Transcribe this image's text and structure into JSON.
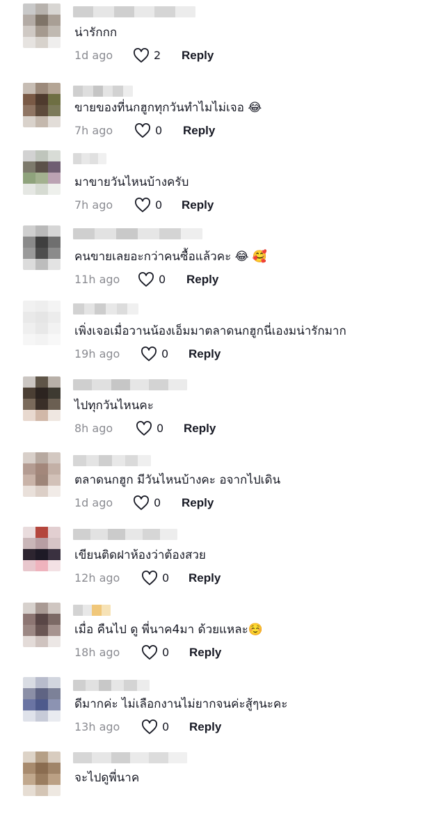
{
  "comments": [
    {
      "text": "น่ารักกก",
      "time": "1d ago",
      "likes": "2",
      "reply": "Reply",
      "avatar": [
        "#c9c9c9",
        "#b7b2ad",
        "#d8d6d3",
        "#b3aba5",
        "#7f7468",
        "#a99f95",
        "#cfc9c4",
        "#a59a8f",
        "#c0b9b1",
        "#e6e3e0",
        "#d7d2cc",
        "#efeeed"
      ],
      "name_blur": [
        "#d0d0d0",
        "#e6e6e6",
        "#cfcfcf",
        "#e9e9e9",
        "#d5d5d5",
        "#ececec"
      ]
    },
    {
      "text": "ขายของที่นกฮูกทุกวันทำไมไม่เจอ 😂",
      "time": "7h ago",
      "likes": "0",
      "reply": "Reply",
      "avatar": [
        "#c7bdb4",
        "#9c8a7b",
        "#b4a595",
        "#7a5a46",
        "#4f3b2e",
        "#6e6f43",
        "#8f7563",
        "#5d4a3b",
        "#7c7a5a",
        "#d9d2cb",
        "#c4b8ad",
        "#e2ddd8"
      ],
      "name_blur": [
        "#cfcfcf",
        "#dedede",
        "#c5c5c5",
        "#e4e4e4",
        "#d2d2d2",
        "#ededed"
      ]
    },
    {
      "text": "มาขายวันไหนบ้างครับ",
      "time": "7h ago",
      "likes": "0",
      "reply": "Reply",
      "avatar": [
        "#d2d2d2",
        "#bfc5bc",
        "#d8dcd6",
        "#7d7a6c",
        "#5b5149",
        "#6f5e72",
        "#8fa37c",
        "#a3b18f",
        "#bba3b3",
        "#e5e7e3",
        "#d6dbd2",
        "#eef0ec"
      ],
      "name_blur": [
        "#dadada",
        "#e8e8e8",
        "#e0e0e0",
        "#f0f0f0"
      ]
    },
    {
      "text": "คนขายเลยอะกว่าคนซื้อแล้วคะ 😂 🥰",
      "time": "11h ago",
      "likes": "0",
      "reply": "Reply",
      "avatar": [
        "#cfcfcf",
        "#b9b9b9",
        "#d6d6d6",
        "#8a8a8a",
        "#3f3f3f",
        "#6f6f6f",
        "#9a9a9a",
        "#4e4e4e",
        "#8b8b8b",
        "#dcdcdc",
        "#bdbdbd",
        "#e3e3e3"
      ],
      "name_blur": [
        "#cfcfcf",
        "#e2e2e2",
        "#c9c9c9",
        "#e6e6e6",
        "#d4d4d4",
        "#eeeeee"
      ]
    },
    {
      "text": "เพิ่งเจอเมื่อวานน้องเอ็มมาตลาดนกฮูกนี่เองมน่ารักมาก",
      "time": "19h ago",
      "likes": "0",
      "reply": "Reply",
      "avatar": [
        "#f1f1f1",
        "#eeeeee",
        "#f4f4f4",
        "#e9e9e9",
        "#e5e5e5",
        "#ececec",
        "#efefef",
        "#e8e8e8",
        "#f2f2f2",
        "#f6f6f6",
        "#f3f3f3",
        "#f8f8f8"
      ],
      "name_blur": [
        "#d2d2d2",
        "#e4e4e4",
        "#cdcdcd",
        "#e8e8e8",
        "#dcdcdc",
        "#f0f0f0"
      ]
    },
    {
      "text": "ไปทุกวันไหนคะ",
      "time": "8h ago",
      "likes": "0",
      "reply": "Reply",
      "avatar": [
        "#cbc6c2",
        "#5f5548",
        "#b8b0a8",
        "#4b3f34",
        "#2c2420",
        "#3e3a31",
        "#7a6a5b",
        "#3a2f28",
        "#6b5f52",
        "#e8d9cf",
        "#d1b8a8",
        "#efe7e1"
      ],
      "name_blur": [
        "#cfcfcf",
        "#e0e0e0",
        "#c6c6c6",
        "#e6e6e6",
        "#d3d3d3",
        "#ebebeb"
      ]
    },
    {
      "text": "ตลาดนกฮูก มีวันไหนบ้างคะ อจากไปเดิน",
      "time": "1d ago",
      "likes": "0",
      "reply": "Reply",
      "avatar": [
        "#d8cfc9",
        "#b7a9a0",
        "#d3c8c1",
        "#b49c92",
        "#a3877b",
        "#c3b0a6",
        "#c9b3a8",
        "#9e8579",
        "#d2c1b8",
        "#e9e0da",
        "#dccfc7",
        "#f1ebe7"
      ],
      "name_blur": [
        "#d6d6d6",
        "#e4e4e4",
        "#cfcfcf",
        "#e8e8e8",
        "#dadada",
        "#efefef"
      ]
    },
    {
      "text": "เขียนติดฝาห้องว่าต้องสวย",
      "time": "12h ago",
      "likes": "0",
      "reply": "Reply",
      "avatar": [
        "#e9dcdd",
        "#b4463d",
        "#e2cfd1",
        "#c9b6b8",
        "#b79ea3",
        "#d6c4c6",
        "#2d2530",
        "#1e1a26",
        "#3a3140",
        "#e8c7cd",
        "#efb3bd",
        "#f3e1e4"
      ],
      "name_blur": [
        "#d0d0d0",
        "#e2e2e2",
        "#cbcbcb",
        "#e7e7e7",
        "#d6d6d6",
        "#ededed"
      ]
    },
    {
      "text": "เมื่อ คืนไป ดู พี่นาค4มา ด้วยแหละ☺️",
      "time": "18h ago",
      "likes": "0",
      "reply": "Reply",
      "avatar": [
        "#d7d1cd",
        "#a99a94",
        "#cfc6c1",
        "#8d7673",
        "#594646",
        "#7c6965",
        "#9c8884",
        "#6a5654",
        "#a6938f",
        "#e3dbd8",
        "#cfc3bf",
        "#ece7e5"
      ],
      "name_blur": [
        "#d3d3d3",
        "#e8e8e8",
        "#f0c77a",
        "#f6e2b6"
      ]
    },
    {
      "text": "ดีมากค่ะ ไม่เลือกงานไม่ยากจนค่ะสู้ๆนะคะ",
      "time": "13h ago",
      "likes": "0",
      "reply": "Reply",
      "avatar": [
        "#d9dce3",
        "#b8bccc",
        "#d2d6df",
        "#8b8fa6",
        "#5f6483",
        "#7c8198",
        "#6a74a3",
        "#4e5a8c",
        "#8c93b2",
        "#dfe2ea",
        "#c7cbd8",
        "#e9ebf0"
      ],
      "name_blur": [
        "#cfcfcf",
        "#e1e1e1",
        "#c8c8c8",
        "#e6e6e6",
        "#d4d4d4",
        "#ececec"
      ]
    },
    {
      "text": "จะไปดูพี่นาค",
      "time": "",
      "likes": "",
      "reply": "",
      "avatar": [
        "#ddd3c7",
        "#b59f86",
        "#d8ccbf",
        "#a88b6e",
        "#8a6c50",
        "#a08468",
        "#c1a88d",
        "#9a7d60",
        "#bba084",
        "#e6ddd3",
        "#d4c5b5",
        "#eee8e1"
      ],
      "name_blur": [
        "#d6d6d6",
        "#e6e6e6",
        "#d0d0d0",
        "#eaeaea",
        "#dcdcdc",
        "#f0f0f0"
      ]
    }
  ]
}
